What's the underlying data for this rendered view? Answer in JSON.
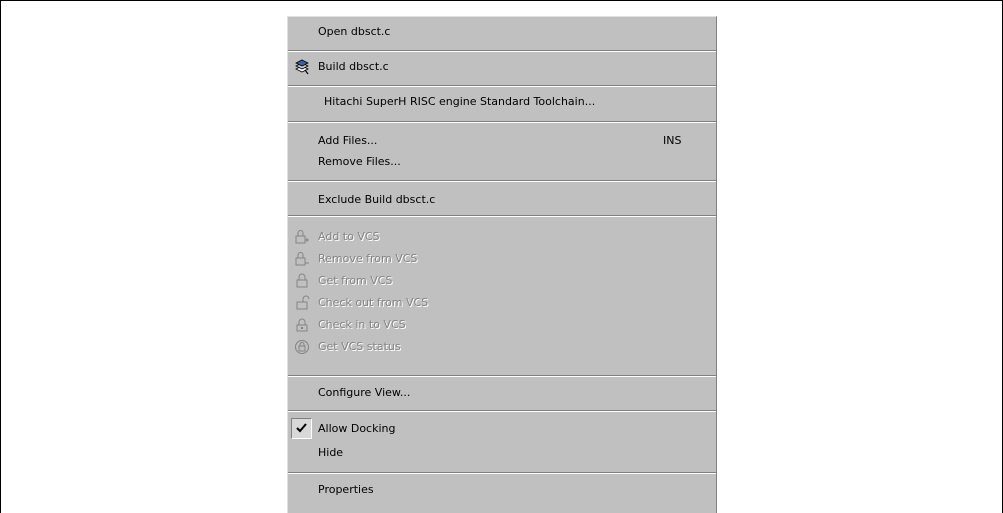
{
  "menu": {
    "open": "Open dbsct.c",
    "build": "Build dbsct.c",
    "toolchain": "Hitachi SuperH RISC engine Standard Toolchain...",
    "add_files": "Add Files...",
    "add_files_shortcut": "INS",
    "remove_files": "Remove Files...",
    "exclude_build": "Exclude Build dbsct.c",
    "vcs": {
      "add": "Add to VCS",
      "remove": "Remove from VCS",
      "get": "Get from VCS",
      "check_out": "Check out from VCS",
      "check_in": "Check in to VCS",
      "status": "Get VCS status"
    },
    "configure_view": "Configure View...",
    "allow_docking": "Allow Docking",
    "allow_docking_checked": true,
    "hide": "Hide",
    "properties": "Properties"
  },
  "icons": {
    "build": "build-icon",
    "vcs_add": "vcs-add-icon",
    "vcs_remove": "vcs-remove-icon",
    "vcs_get": "vcs-get-icon",
    "vcs_check_out": "vcs-check-out-icon",
    "vcs_check_in": "vcs-check-in-icon",
    "vcs_status": "vcs-status-icon",
    "check": "checkmark-icon"
  },
  "colors": {
    "menu_background": "#c0c0c0",
    "disabled_text": "#848484"
  }
}
